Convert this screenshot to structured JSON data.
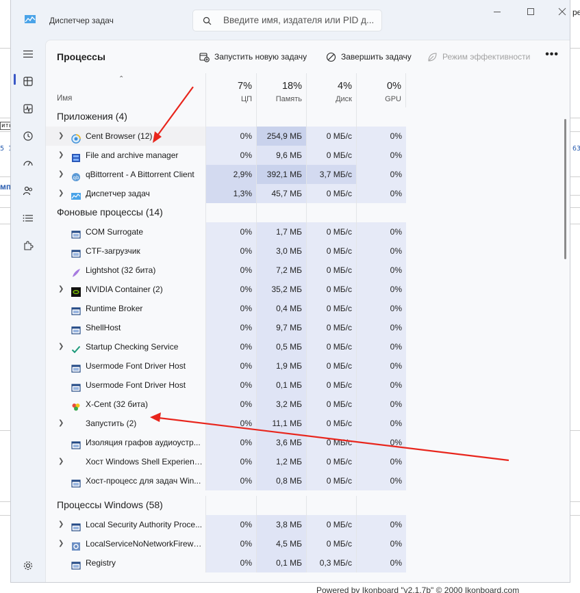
{
  "window": {
    "title": "Диспетчер задач",
    "search_placeholder": "Введите имя, издателя или PID д..."
  },
  "page_title": "Процессы",
  "toolbar": {
    "new_task": "Запустить новую задачу",
    "end_task": "Завершить задачу",
    "efficiency": "Режим эффективности",
    "more": "•••"
  },
  "columns": {
    "name": "Имя",
    "cpu_pct": "7%",
    "cpu": "ЦП",
    "mem_pct": "18%",
    "mem": "Память",
    "disk_pct": "4%",
    "disk": "Диск",
    "gpu_pct": "0%",
    "gpu": "GPU"
  },
  "groups": {
    "apps": "Приложения (4)",
    "background": "Фоновые процессы (14)",
    "windows": "Процессы Windows (58)"
  },
  "apps": [
    {
      "name": "Cent Browser (12)",
      "cpu": "0%",
      "mem": "254,9 МБ",
      "disk": "0 МБ/с",
      "gpu": "0%",
      "icon": "cent-browser-icon",
      "expand": true
    },
    {
      "name": "File and archive manager",
      "cpu": "0%",
      "mem": "9,6 МБ",
      "disk": "0 МБ/с",
      "gpu": "0%",
      "icon": "file-manager-icon",
      "expand": true
    },
    {
      "name": "qBittorrent - A Bittorrent Client",
      "cpu": "2,9%",
      "mem": "392,1 МБ",
      "disk": "3,7 МБ/с",
      "gpu": "0%",
      "icon": "qbittorrent-icon",
      "expand": true
    },
    {
      "name": "Диспетчер задач",
      "cpu": "1,3%",
      "mem": "45,7 МБ",
      "disk": "0 МБ/с",
      "gpu": "0%",
      "icon": "task-manager-icon",
      "expand": true
    }
  ],
  "background": [
    {
      "name": "COM Surrogate",
      "cpu": "0%",
      "mem": "1,7 МБ",
      "disk": "0 МБ/с",
      "gpu": "0%",
      "icon": "window-icon",
      "expand": false
    },
    {
      "name": "CTF-загрузчик",
      "cpu": "0%",
      "mem": "3,0 МБ",
      "disk": "0 МБ/с",
      "gpu": "0%",
      "icon": "window-icon",
      "expand": false
    },
    {
      "name": "Lightshot (32 бита)",
      "cpu": "0%",
      "mem": "7,2 МБ",
      "disk": "0 МБ/с",
      "gpu": "0%",
      "icon": "lightshot-icon",
      "expand": false
    },
    {
      "name": "NVIDIA Container (2)",
      "cpu": "0%",
      "mem": "35,2 МБ",
      "disk": "0 МБ/с",
      "gpu": "0%",
      "icon": "nvidia-icon",
      "expand": true
    },
    {
      "name": "Runtime Broker",
      "cpu": "0%",
      "mem": "0,4 МБ",
      "disk": "0 МБ/с",
      "gpu": "0%",
      "icon": "window-icon",
      "expand": false
    },
    {
      "name": "ShellHost",
      "cpu": "0%",
      "mem": "9,7 МБ",
      "disk": "0 МБ/с",
      "gpu": "0%",
      "icon": "window-icon",
      "expand": false
    },
    {
      "name": "Startup Checking Service",
      "cpu": "0%",
      "mem": "0,5 МБ",
      "disk": "0 МБ/с",
      "gpu": "0%",
      "icon": "checkmark-icon",
      "expand": true
    },
    {
      "name": "Usermode Font Driver Host",
      "cpu": "0%",
      "mem": "1,9 МБ",
      "disk": "0 МБ/с",
      "gpu": "0%",
      "icon": "window-icon",
      "expand": false
    },
    {
      "name": "Usermode Font Driver Host",
      "cpu": "0%",
      "mem": "0,1 МБ",
      "disk": "0 МБ/с",
      "gpu": "0%",
      "icon": "window-icon",
      "expand": false
    },
    {
      "name": "X-Cent (32 бита)",
      "cpu": "0%",
      "mem": "3,2 МБ",
      "disk": "0 МБ/с",
      "gpu": "0%",
      "icon": "x-cent-icon",
      "expand": false
    },
    {
      "name": "Запустить (2)",
      "cpu": "0%",
      "mem": "11,1 МБ",
      "disk": "0 МБ/с",
      "gpu": "0%",
      "icon": "",
      "expand": true
    },
    {
      "name": "Изоляция графов аудиоустр...",
      "cpu": "0%",
      "mem": "3,6 МБ",
      "disk": "0 МБ/с",
      "gpu": "0%",
      "icon": "window-icon",
      "expand": false
    },
    {
      "name": "Хост Windows Shell Experienc...",
      "cpu": "0%",
      "mem": "1,2 МБ",
      "disk": "0 МБ/с",
      "gpu": "0%",
      "icon": "",
      "expand": true
    },
    {
      "name": "Хост-процесс для задач Win...",
      "cpu": "0%",
      "mem": "0,8 МБ",
      "disk": "0 МБ/с",
      "gpu": "0%",
      "icon": "window-icon",
      "expand": false
    }
  ],
  "windows": [
    {
      "name": "Local Security Authority Proce...",
      "cpu": "0%",
      "mem": "3,8 МБ",
      "disk": "0 МБ/с",
      "gpu": "0%",
      "icon": "window-icon",
      "expand": true
    },
    {
      "name": "LocalServiceNoNetworkFirewa...",
      "cpu": "0%",
      "mem": "4,5 МБ",
      "disk": "0 МБ/с",
      "gpu": "0%",
      "icon": "gear-service-icon",
      "expand": true
    },
    {
      "name": "Registry",
      "cpu": "0%",
      "mem": "0,1 МБ",
      "disk": "0,3 МБ/с",
      "gpu": "0%",
      "icon": "window-icon",
      "expand": false
    }
  ],
  "background_page": {
    "footer": "Powered by Ikonboard \"v2.1.7b\" © 2000 Ikonboard.com",
    "fragments": [
      "ре",
      "ить",
      "5 1",
      "63",
      "мп"
    ]
  }
}
